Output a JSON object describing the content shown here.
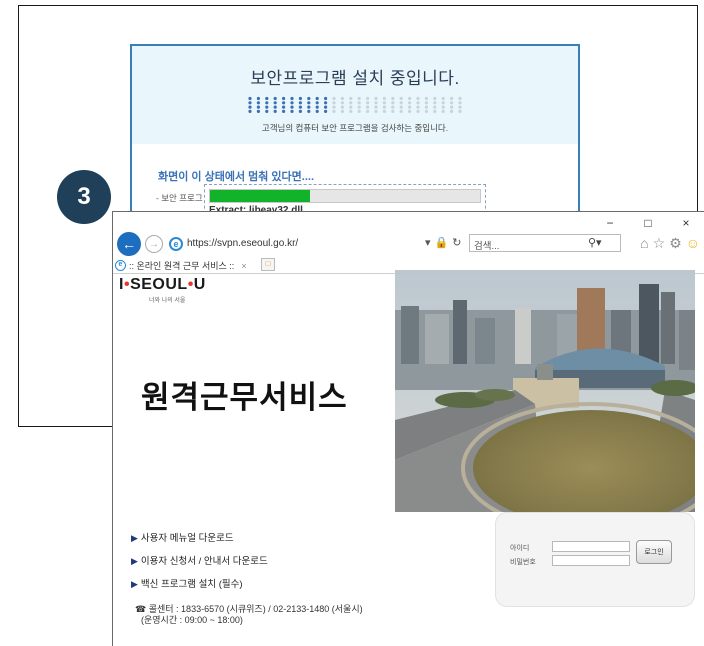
{
  "step_badge": "3",
  "install": {
    "title": "보안프로그램 설치 중입니다.",
    "subtitle": "고객님의 컴퓨터 보안 프로그램을 검사하는 중입니다.",
    "stuck_text": "화면이 이 상태에서 멈춰 있다면....",
    "bullet": "- 보안 프로그",
    "extract_text": "Extract: libeay32.dll",
    "progress": 0.37
  },
  "browser": {
    "window_controls": [
      "−",
      "□",
      "×"
    ],
    "url": "https://svpn.eseoul.go.kr/",
    "search_placeholder": "검색...",
    "tab_title": ":: 온라인 원격 근무 서비스 ::",
    "tab_close": "×"
  },
  "page": {
    "logo_parts": [
      "I",
      "SEOUL",
      "U"
    ],
    "logo_dot": "•",
    "logo_sub": "너와 나의 서울",
    "main_title": "원격근무서비스",
    "links": [
      "사용자 메뉴얼 다운로드",
      "이용자 신청서 / 안내서 다운로드",
      "백신 프로그램 설치 (필수)"
    ],
    "callcenter_line1": "☎ 콜센터 : 1833-6570 (시큐위즈) / 02-2133-1480 (서울시)",
    "callcenter_line2": "(운영시간 : 09:00 ~ 18:00)",
    "login": {
      "id_label": "아이디",
      "pw_label": "비밀번호",
      "button": "로그인"
    }
  },
  "colors": {
    "accent_blue": "#1e6ec0",
    "progress_green": "#12b22a",
    "badge": "#1f4058",
    "logo_dot": "#e8362d"
  }
}
